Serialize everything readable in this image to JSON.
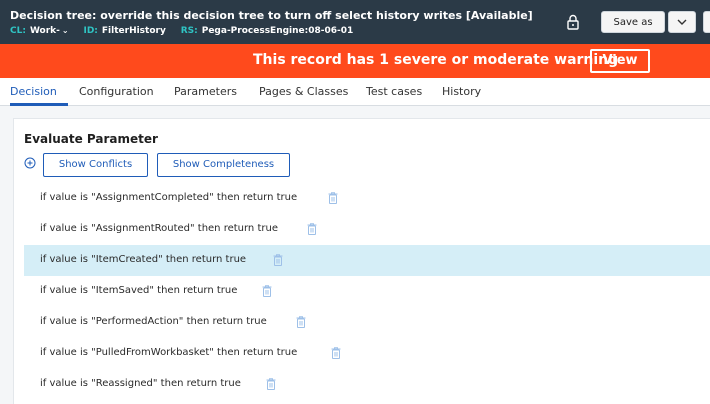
{
  "header": {
    "title": "Decision tree: override this decision tree to turn off select history writes [Available]",
    "meta": [
      {
        "key": "CL:",
        "value": "Work-",
        "has_dropdown": true
      },
      {
        "key": "ID:",
        "value": "FilterHistory",
        "has_dropdown": false
      },
      {
        "key": "RS:",
        "value": "Pega-ProcessEngine:08-06-01",
        "has_dropdown": false
      }
    ],
    "save_as_label": "Save as",
    "icons": {
      "lock": "lock-icon",
      "caret": "chevron-down-icon"
    }
  },
  "banner": {
    "message": "This record has 1 severe or moderate warning",
    "view_label": "View",
    "color": "#ff4a1c"
  },
  "tabs": [
    {
      "label": "Decision",
      "active": true
    },
    {
      "label": "Configuration",
      "active": false
    },
    {
      "label": "Parameters",
      "active": false
    },
    {
      "label": "Pages & Classes",
      "active": false
    },
    {
      "label": "Test cases",
      "active": false
    },
    {
      "label": "History",
      "active": false
    }
  ],
  "decision": {
    "section_title": "Evaluate Parameter",
    "show_conflicts_label": "Show Conflicts",
    "show_completeness_label": "Show Completeness",
    "rows": [
      {
        "text": "if  value is \"AssignmentCompleted\" then return true",
        "highlighted": false
      },
      {
        "text": "if  value is \"AssignmentRouted\" then return true",
        "highlighted": false
      },
      {
        "text": "if  value is \"ItemCreated\" then return true",
        "highlighted": true
      },
      {
        "text": "if  value is \"ItemSaved\" then return true",
        "highlighted": false
      },
      {
        "text": "if  value is \"PerformedAction\" then return true",
        "highlighted": false
      },
      {
        "text": "if  value is \"PulledFromWorkbasket\" then return true",
        "highlighted": false
      },
      {
        "text": "if  value is \"Reassigned\" then return true",
        "highlighted": false
      }
    ]
  },
  "colors": {
    "header_bg": "#2b3a47",
    "accent": "#1f5cb8",
    "meta_key": "#2fc4c4",
    "row_highlight": "#d5eef7"
  }
}
